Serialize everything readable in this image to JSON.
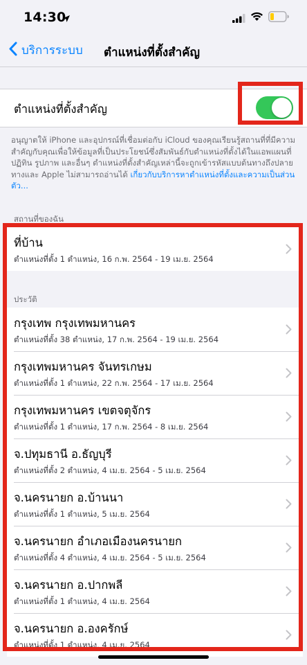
{
  "status_bar": {
    "time": "14:30"
  },
  "nav": {
    "back_label": "บริการระบบ",
    "title": "ตำแหน่งที่ตั้งสำคัญ"
  },
  "toggle": {
    "label": "ตำแหน่งที่ตั้งสำคัญ",
    "state": "on",
    "accent_color": "#34c759"
  },
  "footer": {
    "text": "อนุญาตให้ iPhone และอุปกรณ์ที่เชื่อมต่อกับ iCloud ของคุณเรียนรู้สถานที่ที่มีความสำคัญกับคุณเพื่อให้ข้อมูลที่เป็นประโยชน์ซึ่งสัมพันธ์กับตำแหน่งที่ตั้งได้ในแอพแผนที่ ปฏิทิน รูปภาพ และอื่นๆ ตำแหน่งที่ตั้งสำคัญเหล่านี้จะถูกเข้ารหัสแบบต้นทางถึงปลายทางและ Apple ไม่สามารถอ่านได้ ",
    "link": "เกี่ยวกับบริการหาตำแหน่งที่ตั้งและความเป็นส่วนตัว..."
  },
  "my_places": {
    "header": "สถานที่ของฉัน",
    "items": [
      {
        "title": "ที่บ้าน",
        "subtitle": "ตำแหน่งที่ตั้ง 1 ตำแหน่ง, 16 ก.พ. 2564 - 19 เม.ย. 2564"
      }
    ]
  },
  "history": {
    "header": "ประวัติ",
    "items": [
      {
        "title": "กรุงเทพ กรุงเทพมหานคร",
        "subtitle": "ตำแหน่งที่ตั้ง 38 ตำแหน่ง, 17 ก.พ. 2564 - 19 เม.ย. 2564"
      },
      {
        "title": "กรุงเทพมหานคร จันทรเกษม",
        "subtitle": "ตำแหน่งที่ตั้ง 1 ตำแหน่ง, 22 ก.พ. 2564 - 17 เม.ย. 2564"
      },
      {
        "title": "กรุงเทพมหานคร เขตจตุจักร",
        "subtitle": "ตำแหน่งที่ตั้ง 1 ตำแหน่ง, 17 ก.พ. 2564 - 8 เม.ย. 2564"
      },
      {
        "title": "จ.ปทุมธานี อ.ธัญบุรี",
        "subtitle": "ตำแหน่งที่ตั้ง 2 ตำแหน่ง, 4 เม.ย. 2564 - 5 เม.ย. 2564"
      },
      {
        "title": "จ.นครนายก อ.บ้านนา",
        "subtitle": "ตำแหน่งที่ตั้ง 1 ตำแหน่ง, 5 เม.ย. 2564"
      },
      {
        "title": "จ.นครนายก อำเภอเมืองนครนายก",
        "subtitle": "ตำแหน่งที่ตั้ง 4 ตำแหน่ง, 4 เม.ย. 2564 - 5 เม.ย. 2564"
      },
      {
        "title": "จ.นครนายก อ.ปากพลี",
        "subtitle": "ตำแหน่งที่ตั้ง 1 ตำแหน่ง, 4 เม.ย. 2564"
      },
      {
        "title": "จ.นครนายก อ.องครักษ์",
        "subtitle": "ตำแหน่งที่ตั้ง 1 ตำแหน่ง, 4 เม.ย. 2564"
      }
    ]
  },
  "colors": {
    "link": "#0a84ff",
    "highlight": "#e3261b",
    "background": "#f2f2f7"
  }
}
